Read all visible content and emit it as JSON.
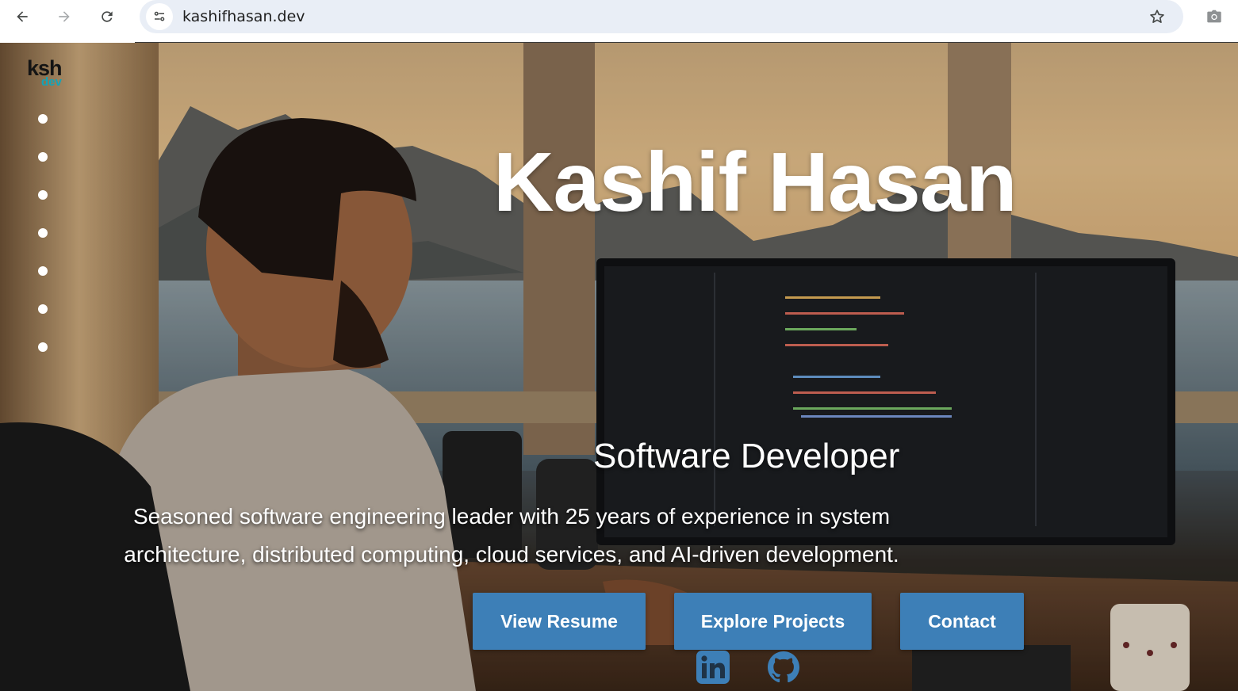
{
  "browser": {
    "url": "kashifhasan.dev",
    "icons": {
      "back": "back-arrow-icon",
      "forward": "forward-arrow-icon",
      "reload": "reload-icon",
      "site_info": "site-settings-icon",
      "bookmark": "star-icon",
      "screenshot": "camera-icon"
    }
  },
  "brand": {
    "primary": "ksh",
    "secondary": "dev",
    "accent_color": "#12a4b8"
  },
  "dot_nav": {
    "count": 7
  },
  "hero": {
    "name": "Kashif Hasan",
    "role": "Software Developer",
    "bio": "Seasoned software engineering leader with 25 years of experience in system architecture, distributed computing, cloud services, and AI-driven development."
  },
  "actions": {
    "resume": "View Resume",
    "projects": "Explore Projects",
    "contact": "Contact",
    "button_color": "#3d7fb7"
  },
  "social": {
    "linkedin": "linkedin-icon",
    "github": "github-icon",
    "icon_color": "#3d7fb7"
  }
}
